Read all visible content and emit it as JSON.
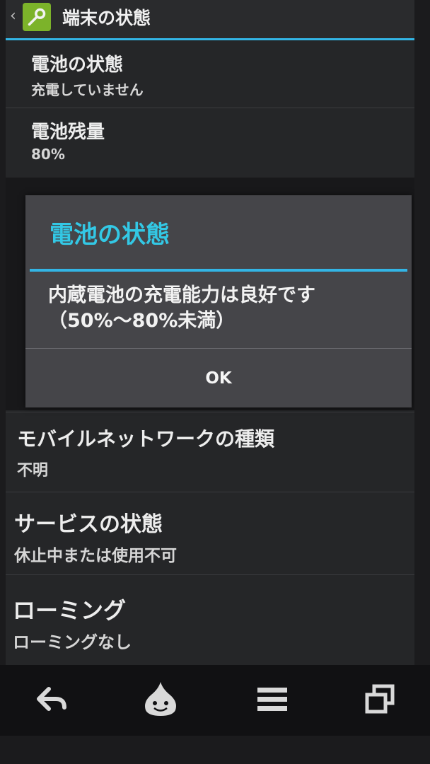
{
  "actionbar": {
    "title": "端末の状態"
  },
  "list": [
    {
      "title": "電池の状態",
      "subtitle": "充電していません"
    },
    {
      "title": "電池残量",
      "subtitle": "80%"
    },
    {
      "title": "モバイルネットワークの種類",
      "subtitle": "不明"
    },
    {
      "title": "サービスの状態",
      "subtitle": "休止中または使用不可"
    },
    {
      "title": "ローミング",
      "subtitle": "ローミングなし"
    }
  ],
  "dialog": {
    "title": "電池の状態",
    "body": "内蔵電池の充電能力は良好です（50%〜80%未満）",
    "ok": "OK"
  },
  "icons": {
    "back": "back-arrow-icon",
    "home": "slime-home-icon",
    "menu": "menu-icon",
    "recents": "recent-apps-icon"
  },
  "colors": {
    "accent": "#33b5e5",
    "dialog_title": "#33c8e5",
    "app_icon_bg": "#7cb32a"
  }
}
